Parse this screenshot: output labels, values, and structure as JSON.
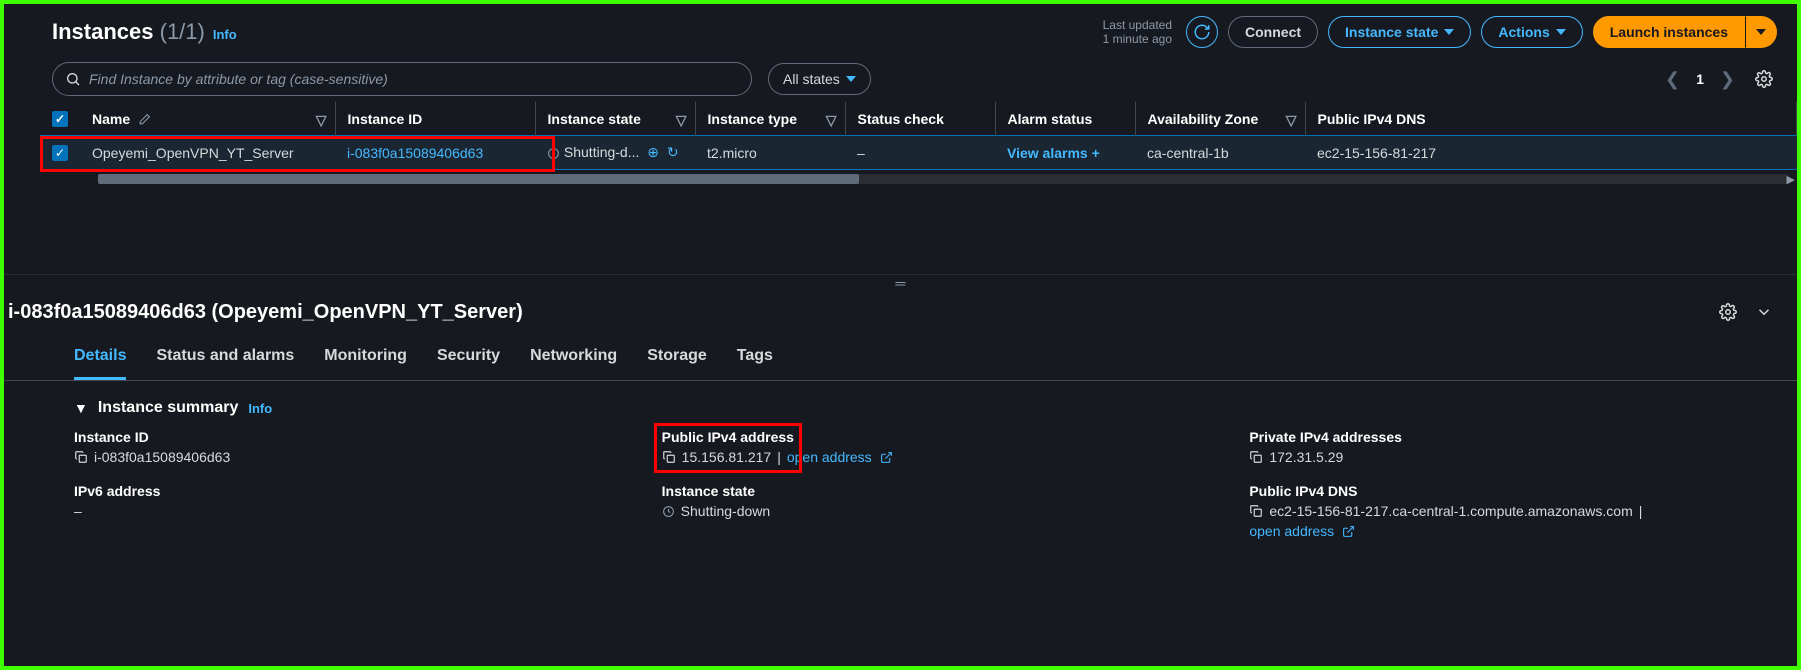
{
  "header": {
    "title": "Instances",
    "count": "(1/1)",
    "info": "Info",
    "lastUpdatedLabel": "Last updated",
    "lastUpdatedValue": "1 minute ago",
    "connect": "Connect",
    "instanceState": "Instance state",
    "actions": "Actions",
    "launch": "Launch instances"
  },
  "toolbar": {
    "searchPlaceholder": "Find Instance by attribute or tag (case-sensitive)",
    "allStates": "All states",
    "page": "1"
  },
  "columns": {
    "name": "Name",
    "instanceId": "Instance ID",
    "instanceState": "Instance state",
    "instanceType": "Instance type",
    "statusCheck": "Status check",
    "alarmStatus": "Alarm status",
    "az": "Availability Zone",
    "publicDns": "Public IPv4 DNS"
  },
  "row": {
    "name": "Opeyemi_OpenVPN_YT_Server",
    "instanceId": "i-083f0a15089406d63",
    "state": "Shutting-d...",
    "type": "t2.micro",
    "statusCheck": "–",
    "alarm": "View alarms",
    "az": "ca-central-1b",
    "dns": "ec2-15-156-81-217"
  },
  "detail": {
    "title": "i-083f0a15089406d63 (Opeyemi_OpenVPN_YT_Server)",
    "tabs": {
      "details": "Details",
      "status": "Status and alarms",
      "monitoring": "Monitoring",
      "security": "Security",
      "networking": "Networking",
      "storage": "Storage",
      "tags": "Tags"
    },
    "summaryTitle": "Instance summary",
    "summaryInfo": "Info",
    "fields": {
      "instanceIdLabel": "Instance ID",
      "instanceIdValue": "i-083f0a15089406d63",
      "ipv6Label": "IPv6 address",
      "ipv6Value": "–",
      "publicIpLabel": "Public IPv4 address",
      "publicIpValue": "15.156.81.217",
      "openAddress": "open address",
      "instanceStateLabel": "Instance state",
      "instanceStateValue": "Shutting-down",
      "privateIpLabel": "Private IPv4 addresses",
      "privateIpValue": "172.31.5.29",
      "publicDnsLabel": "Public IPv4 DNS",
      "publicDnsValue": "ec2-15-156-81-217.ca-central-1.compute.amazonaws.com",
      "openAddress2": "open address"
    }
  }
}
